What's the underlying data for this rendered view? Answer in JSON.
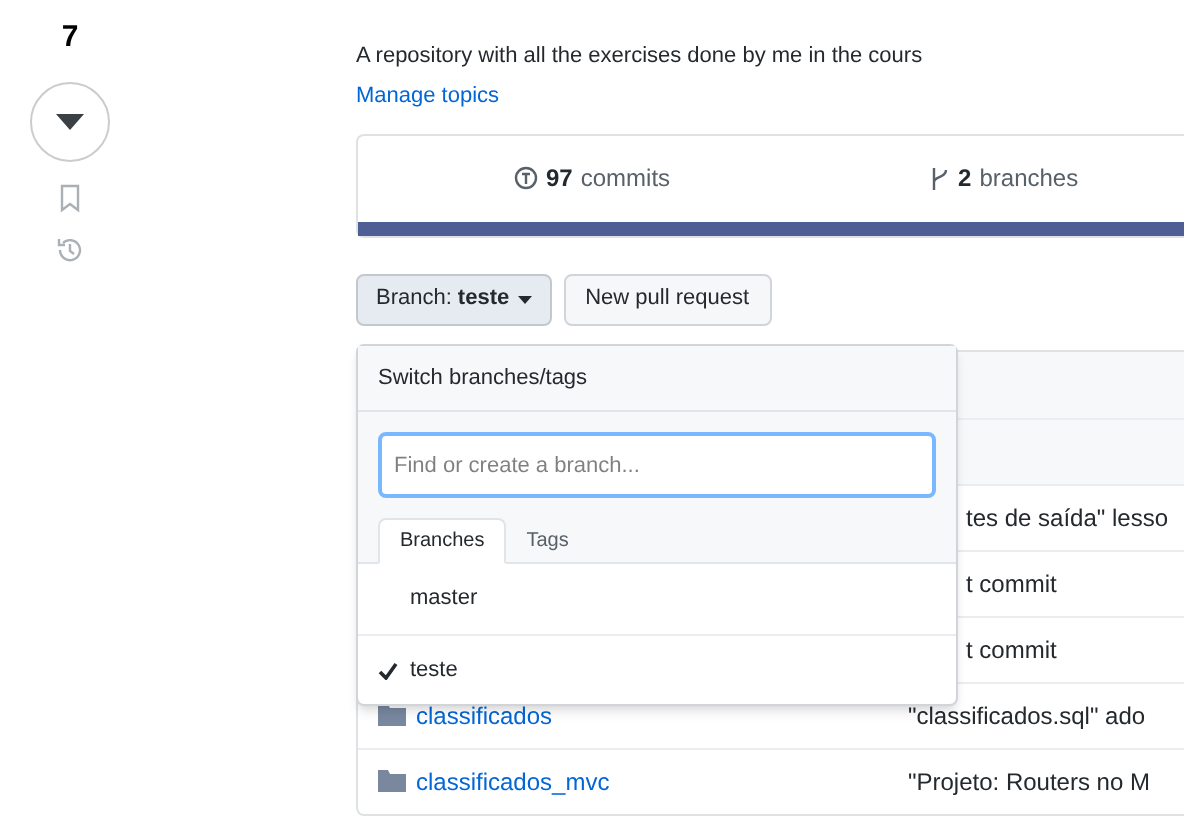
{
  "sidebar": {
    "count": "7",
    "actions": [
      {
        "kind": "bookmark"
      },
      {
        "kind": "history"
      }
    ]
  },
  "repo": {
    "description": "A repository with all the exercises done by me in the cours",
    "manage_topics": "Manage topics",
    "stats": [
      {
        "kind": "commits",
        "value": "97",
        "label": "commits"
      },
      {
        "kind": "branches",
        "value": "2",
        "label": "branches"
      }
    ],
    "branch_button": {
      "prefix": "Branch:",
      "branch": "teste"
    },
    "pull_request_button": "New pull request",
    "rows": [
      {
        "kind": "blank",
        "name": "",
        "message": ""
      },
      {
        "kind": "blank",
        "name": "",
        "message": ""
      },
      {
        "kind": "text",
        "name": "",
        "message": "tes de saída\" lesso"
      },
      {
        "kind": "text",
        "name": "",
        "message": "t commit"
      },
      {
        "kind": "text",
        "name": "",
        "message": "t commit"
      },
      {
        "kind": "folder",
        "name": "classificados",
        "message": "\"classificados.sql\" ado"
      },
      {
        "kind": "folder",
        "name": "classificados_mvc",
        "message": "\"Projeto: Routers no M"
      }
    ]
  },
  "branch_menu": {
    "title": "Switch branches/tags",
    "search": {
      "placeholder": "Find or create a branch..."
    },
    "tabs": [
      {
        "label": "Branches",
        "selected": true
      },
      {
        "label": "Tags",
        "selected": false
      }
    ],
    "branches": [
      {
        "name": "master",
        "selected": false
      },
      {
        "name": "teste",
        "selected": true
      }
    ]
  }
}
